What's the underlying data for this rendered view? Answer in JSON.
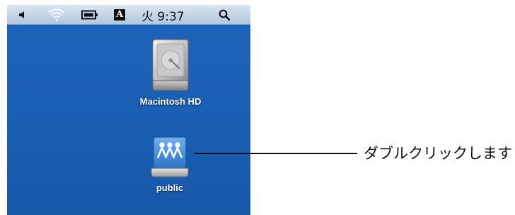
{
  "menubar": {
    "icons": {
      "volume": "speaker-icon",
      "wifi": "wifi-icon",
      "battery": "battery-icon",
      "input_menu": "input-menu-icon",
      "spotlight": "spotlight-search-icon"
    },
    "input_menu_label": "A",
    "clock": "火 9:37"
  },
  "desktop": {
    "background_color": "#1a5fb3",
    "icons": [
      {
        "label": "Macintosh HD",
        "icon": "hard-drive-icon"
      },
      {
        "label": "public",
        "icon": "shared-network-volume-icon"
      }
    ]
  },
  "callout": {
    "text": "ダブルクリックします"
  }
}
